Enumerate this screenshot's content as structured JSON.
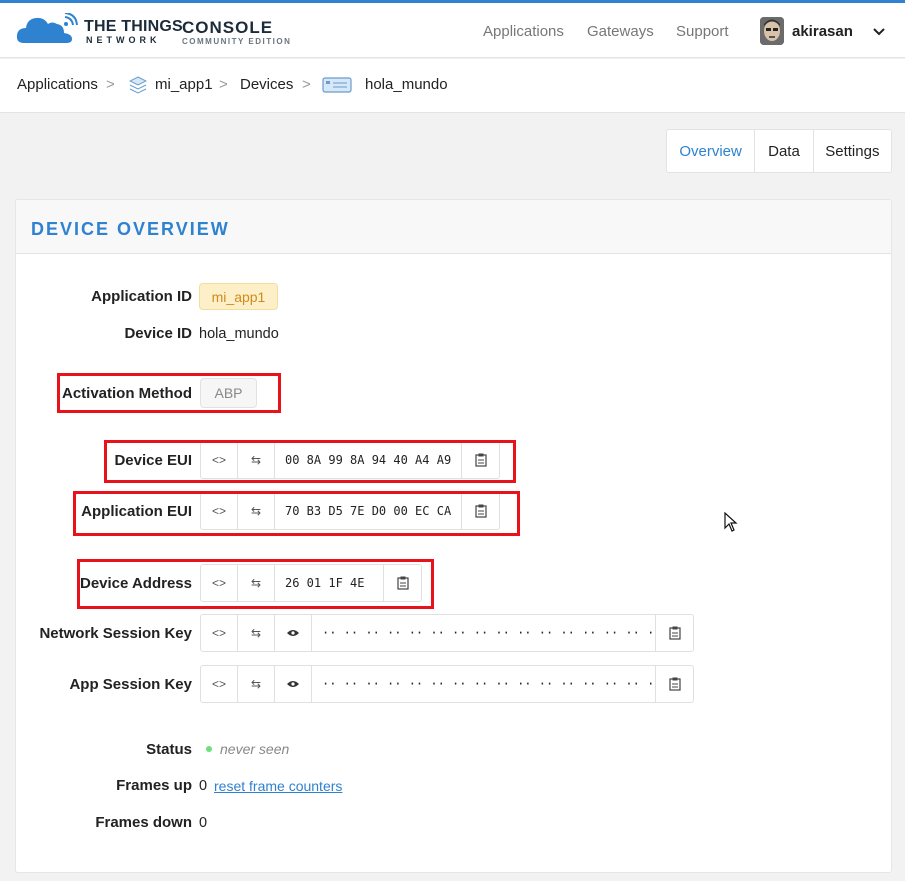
{
  "header": {
    "brand_line1": "THE THINGS",
    "brand_line2": "NETWORK",
    "console_title": "CONSOLE",
    "console_subtitle": "COMMUNITY EDITION",
    "nav": [
      "Applications",
      "Gateways",
      "Support"
    ],
    "username": "akirasan",
    "accent": "#2e82d0"
  },
  "breadcrumb": {
    "items": [
      "Applications",
      "mi_app1",
      "Devices",
      "hola_mundo"
    ],
    "separator": ">"
  },
  "tabs": [
    "Overview",
    "Data",
    "Settings"
  ],
  "overview": {
    "title": "DEVICE OVERVIEW",
    "application_id_label": "Application ID",
    "application_id": "mi_app1",
    "device_id_label": "Device ID",
    "device_id": "hola_mundo",
    "activation_method_label": "Activation Method",
    "activation_method": "ABP",
    "device_eui_label": "Device EUI",
    "device_eui": "00 8A 99 8A 94 40 A4 A9",
    "application_eui_label": "Application EUI",
    "application_eui": "70 B3 D5 7E D0 00 EC CA",
    "device_address_label": "Device Address",
    "device_address": "26 01 1F 4E",
    "network_session_key_label": "Network Session Key",
    "network_session_key": "·· ·· ·· ·· ·· ·· ·· ·· ·· ·· ·· ·· ·· ·· ·· ··",
    "app_session_key_label": "App Session Key",
    "app_session_key": "·· ·· ·· ·· ·· ·· ·· ·· ·· ·· ·· ·· ·· ·· ·· ··",
    "status_label": "Status",
    "status_value": "never seen",
    "frames_up_label": "Frames up",
    "frames_up": "0",
    "reset_link": "reset frame counters",
    "frames_down_label": "Frames down",
    "frames_down": "0"
  },
  "icons": {
    "code": "<>",
    "swap": "⇆"
  },
  "colors": {
    "highlight_box": "#e8121b",
    "status_dot": "#6ce07a",
    "app_id_pill": "#fdf0c8"
  }
}
